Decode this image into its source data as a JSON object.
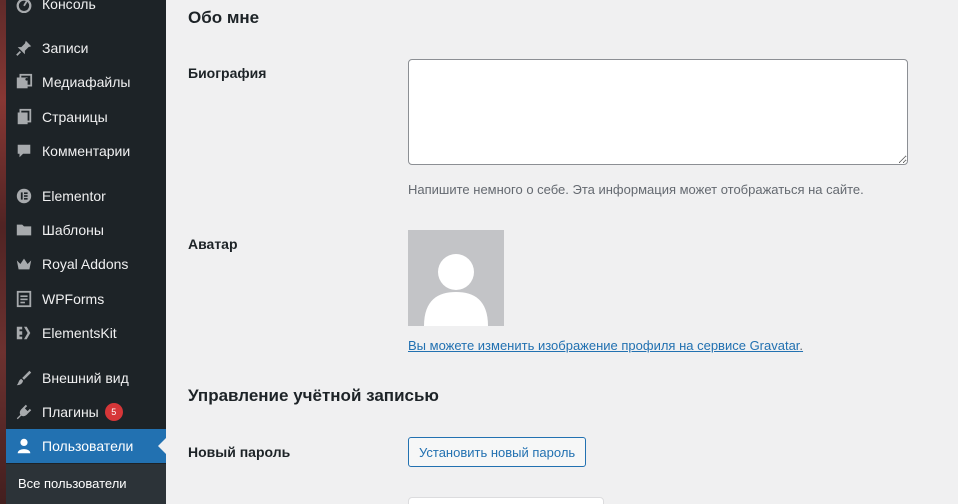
{
  "sidebar": {
    "items": [
      {
        "label": "Консоль",
        "icon": "dashboard-icon"
      },
      {
        "label": "Записи",
        "icon": "pin-icon"
      },
      {
        "label": "Медиафайлы",
        "icon": "media-icon"
      },
      {
        "label": "Страницы",
        "icon": "pages-icon"
      },
      {
        "label": "Комментарии",
        "icon": "comment-icon"
      },
      {
        "label": "Elementor",
        "icon": "elementor-icon"
      },
      {
        "label": "Шаблоны",
        "icon": "folder-icon"
      },
      {
        "label": "Royal Addons",
        "icon": "crown-icon"
      },
      {
        "label": "WPForms",
        "icon": "forms-icon"
      },
      {
        "label": "ElementsKit",
        "icon": "elementskit-icon"
      },
      {
        "label": "Внешний вид",
        "icon": "brush-icon"
      },
      {
        "label": "Плагины",
        "icon": "plugin-icon",
        "badge": "5"
      },
      {
        "label": "Пользователи",
        "icon": "user-icon",
        "active": true
      }
    ],
    "submenu": {
      "label": "Все пользователи"
    },
    "colors": {
      "bg": "#1d2327",
      "active": "#2271b1",
      "badge": "#d63638"
    }
  },
  "about": {
    "heading": "Обо мне",
    "bio_label": "Биография",
    "bio_value": "",
    "bio_description": "Напишите немного о себе. Эта информация может отображаться на сайте.",
    "avatar_label": "Аватар",
    "gravatar_link": "Вы можете изменить изображение профиля на сервисе Gravatar",
    "gravatar_suffix": "."
  },
  "account": {
    "heading": "Управление учётной записью",
    "password_label": "Новый пароль",
    "set_password_button": "Установить новый пароль"
  }
}
